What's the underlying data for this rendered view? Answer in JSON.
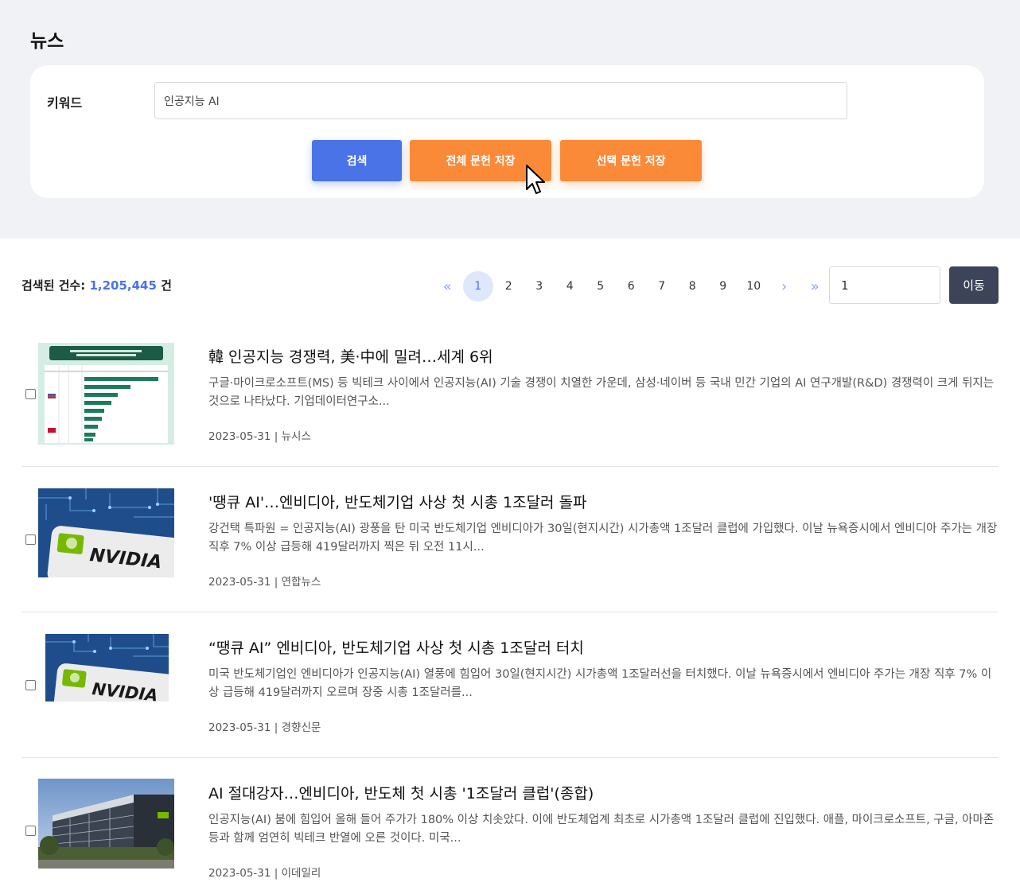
{
  "page": {
    "title": "뉴스"
  },
  "search": {
    "keyword_label": "키워드",
    "keyword_value": "인공지능 AI",
    "search_label": "검색",
    "save_all_label": "전체 문헌 저장",
    "save_selected_label": "선택 문헌 저장"
  },
  "results": {
    "count_label": "검색된 건수:",
    "count_value": "1,205,445",
    "count_unit": "건"
  },
  "pagination": {
    "first": "«",
    "prev": "‹",
    "next": "›",
    "last": "»",
    "pages": [
      "1",
      "2",
      "3",
      "4",
      "5",
      "6",
      "7",
      "8",
      "9",
      "10"
    ],
    "current": "1",
    "goto_value": "1",
    "goto_label": "이동"
  },
  "articles": [
    {
      "title": "韓 인공지능 경쟁력, 美·中에 밀려…세계 6위",
      "summary": "구글·마이크로소프트(MS) 등 빅테크 사이에서 인공지능(AI) 기술 경쟁이 치열한 가운데, 삼성·네이버 등 국내 민간 기업의 AI 연구개발(R&D) 경쟁력이 크게 뒤지는 것으로 나타났다. 기업데이터연구소...",
      "date": "2023-05-31",
      "source": "뉴시스",
      "thumb": "chart"
    },
    {
      "title": "'땡큐 AI'…엔비디아, 반도체기업 사상 첫 시총 1조달러 돌파",
      "summary": "강건택 특파원 = 인공지능(AI) 광풍을 탄 미국 반도체기업 엔비디아가 30일(현지시간) 시가총액 1조달러 클럽에 가입했다. 이날 뉴욕증시에서 엔비디아 주가는 개장 직후 7% 이상 급등해 419달러까지 찍은 뒤 오전 11시...",
      "date": "2023-05-31",
      "source": "연합뉴스",
      "thumb": "nvidia"
    },
    {
      "title": "“땡큐 AI” 엔비디아, 반도체기업 사상 첫 시총 1조달러 터치",
      "summary": "미국 반도체기업인 엔비디아가 인공지능(AI) 열풍에 힘입어 30일(현지시간) 시가총액 1조달러선을 터치했다. 이날 뉴욕증시에서 엔비디아 주가는 개장 직후 7% 이상 급등해 419달러까지 오르며 장중 시총 1조달러를...",
      "date": "2023-05-31",
      "source": "경향신문",
      "thumb": "nvidia"
    },
    {
      "title": "AI 절대강자…엔비디아, 반도체 첫 시총 '1조달러 클럽'(종합)",
      "summary": "인공지능(AI) 붐에 힘입어 올해 들어 주가가 180% 이상 치솟았다. 이에 반도체업계 최초로 시가총액 1조달러 클럽에 진입했다. 애플, 마이크로소프트, 구글, 아마존 등과 함께 엄연히 빅테크 반열에 오른 것이다. 미국...",
      "date": "2023-05-31",
      "source": "이데일리",
      "thumb": "building"
    }
  ]
}
